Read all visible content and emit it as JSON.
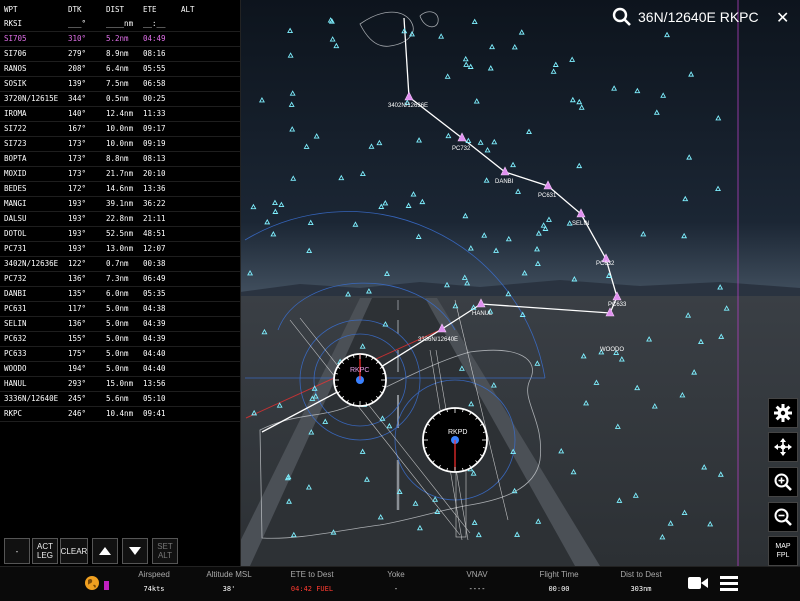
{
  "search": {
    "text": "36N/12640E RKPC"
  },
  "fpl": {
    "headers": {
      "wpt": "WPT",
      "dtk": "DTK",
      "dist": "DIST",
      "ete": "ETE",
      "alt": "ALT"
    },
    "origin": {
      "wpt": "RKSI",
      "dtk": "___°",
      "dist": "____nm",
      "ete": "__:__"
    },
    "rows": [
      {
        "wpt": "SI705",
        "dtk": "310°",
        "dist": "5.2nm",
        "ete": "04:49",
        "active": true
      },
      {
        "wpt": "SI706",
        "dtk": "279°",
        "dist": "8.9nm",
        "ete": "08:16"
      },
      {
        "wpt": "RANOS",
        "dtk": "208°",
        "dist": "6.4nm",
        "ete": "05:55"
      },
      {
        "wpt": "SOSIK",
        "dtk": "139°",
        "dist": "7.5nm",
        "ete": "06:58"
      },
      {
        "wpt": "3720N/12615E",
        "dtk": "344°",
        "dist": "0.5nm",
        "ete": "00:25"
      },
      {
        "wpt": "IROMA",
        "dtk": "140°",
        "dist": "12.4nm",
        "ete": "11:33"
      },
      {
        "wpt": "SI722",
        "dtk": "167°",
        "dist": "10.0nm",
        "ete": "09:17"
      },
      {
        "wpt": "SI723",
        "dtk": "173°",
        "dist": "10.0nm",
        "ete": "09:19"
      },
      {
        "wpt": "BOPTA",
        "dtk": "173°",
        "dist": "8.8nm",
        "ete": "08:13"
      },
      {
        "wpt": "MOXID",
        "dtk": "173°",
        "dist": "21.7nm",
        "ete": "20:10"
      },
      {
        "wpt": "BEDES",
        "dtk": "172°",
        "dist": "14.6nm",
        "ete": "13:36"
      },
      {
        "wpt": "MANGI",
        "dtk": "193°",
        "dist": "39.1nm",
        "ete": "36:22"
      },
      {
        "wpt": "DALSU",
        "dtk": "193°",
        "dist": "22.8nm",
        "ete": "21:11"
      },
      {
        "wpt": "DOTOL",
        "dtk": "193°",
        "dist": "52.5nm",
        "ete": "48:51"
      },
      {
        "wpt": "PC731",
        "dtk": "193°",
        "dist": "13.0nm",
        "ete": "12:07"
      },
      {
        "wpt": "3402N/12636E",
        "dtk": "122°",
        "dist": "0.7nm",
        "ete": "00:38"
      },
      {
        "wpt": "PC732",
        "dtk": "136°",
        "dist": "7.3nm",
        "ete": "06:49"
      },
      {
        "wpt": "DANBI",
        "dtk": "135°",
        "dist": "6.0nm",
        "ete": "05:35"
      },
      {
        "wpt": "PC631",
        "dtk": "117°",
        "dist": "5.0nm",
        "ete": "04:38"
      },
      {
        "wpt": "SELIN",
        "dtk": "136°",
        "dist": "5.0nm",
        "ete": "04:39"
      },
      {
        "wpt": "PC632",
        "dtk": "155°",
        "dist": "5.0nm",
        "ete": "04:39"
      },
      {
        "wpt": "PC633",
        "dtk": "175°",
        "dist": "5.0nm",
        "ete": "04:40"
      },
      {
        "wpt": "WOODO",
        "dtk": "194°",
        "dist": "5.0nm",
        "ete": "04:40"
      },
      {
        "wpt": "HANUL",
        "dtk": "293°",
        "dist": "15.0nm",
        "ete": "13:56"
      },
      {
        "wpt": "3336N/12640E",
        "dtk": "245°",
        "dist": "5.6nm",
        "ete": "05:10"
      },
      {
        "wpt": "RKPC",
        "dtk": "246°",
        "dist": "10.4nm",
        "ete": "09:41"
      }
    ],
    "buttons": {
      "minus": "-",
      "act_leg_1": "ACT",
      "act_leg_2": "LEG",
      "clear": "CLEAR",
      "set_alt_1": "SET",
      "set_alt_2": "ALT"
    }
  },
  "map": {
    "route_labels": [
      "3402N/12636E",
      "PC732",
      "DANBI",
      "PC631",
      "SELIN",
      "PC632",
      "PC633",
      "WOODO",
      "HANUL",
      "3336N/12640E"
    ],
    "airports": {
      "rkpc": "RKPC",
      "rkpd": "RKPD"
    },
    "route_color": "#e090f0"
  },
  "tools": {
    "map_fpl_1": "MAP",
    "map_fpl_2": "FPL",
    "icons": [
      "gear-icon",
      "recenter-icon",
      "zoom-in-icon",
      "zoom-out-icon"
    ]
  },
  "status": {
    "airspeed": {
      "label": "Airspeed",
      "value": "74kts"
    },
    "altitude": {
      "label": "Altitude MSL",
      "value": "38'"
    },
    "ete": {
      "label": "ETE to Dest",
      "value": "04:42 FUEL"
    },
    "yoke": {
      "label": "Yoke",
      "value": "-"
    },
    "vnav": {
      "label": "VNAV",
      "value": "----"
    },
    "flight_time": {
      "label": "Flight Time",
      "value": "00:00"
    },
    "dist": {
      "label": "Dist to Dest",
      "value": "303nm"
    }
  }
}
